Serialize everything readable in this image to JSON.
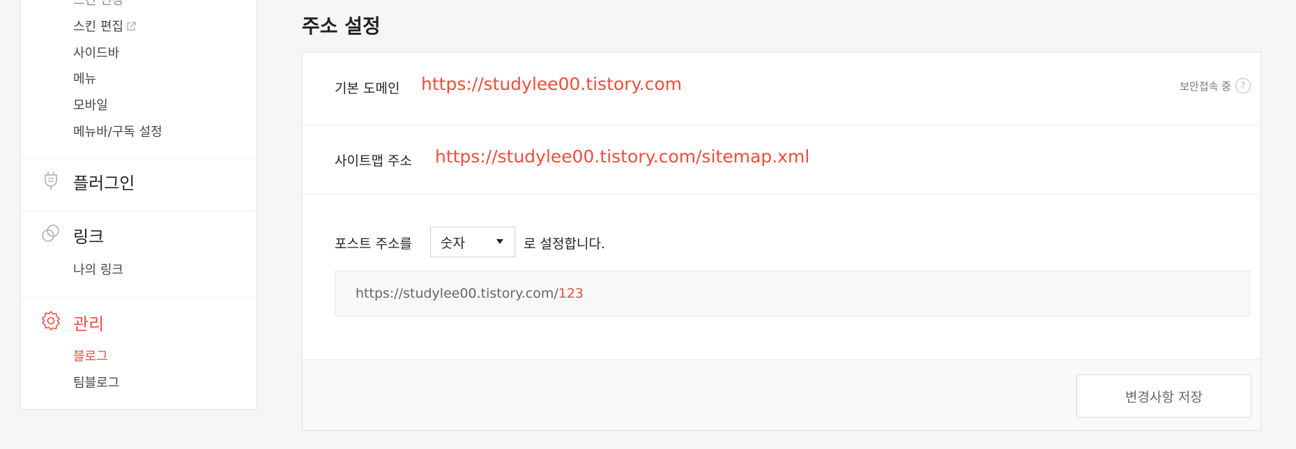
{
  "sidebar": {
    "top_cut_item": "스킨 변경",
    "design_items": [
      {
        "label": "스킨 편집"
      },
      {
        "label": "사이드바"
      },
      {
        "label": "메뉴"
      },
      {
        "label": "모바일"
      },
      {
        "label": "메뉴바/구독 설정"
      }
    ],
    "plugin": {
      "label": "플러그인",
      "icon": "plug-icon"
    },
    "link": {
      "label": "링크",
      "icon": "link-icon",
      "items": [
        {
          "label": "나의 링크"
        }
      ]
    },
    "manage": {
      "label": "관리",
      "icon": "gear-icon",
      "items": [
        {
          "label": "블로그",
          "active": true
        },
        {
          "label": "팀블로그"
        }
      ]
    }
  },
  "main": {
    "title": "주소 설정",
    "default_domain": {
      "label": "기본 도메인",
      "value": "https://studylee00.tistory.com",
      "secure_text": "보안접속 중",
      "help": "?"
    },
    "sitemap": {
      "label": "사이트맵 주소",
      "value": "https://studylee00.tistory.com/sitemap.xml"
    },
    "post_address": {
      "prefix": "포스트 주소를",
      "select_value": "숫자",
      "suffix": "로 설정합니다.",
      "preview_base": "https://studylee00.tistory.com/",
      "preview_num": "123"
    },
    "save_label": "변경사항 저장"
  },
  "colors": {
    "accent": "#f04d3c",
    "background": "#f5f6f8"
  }
}
